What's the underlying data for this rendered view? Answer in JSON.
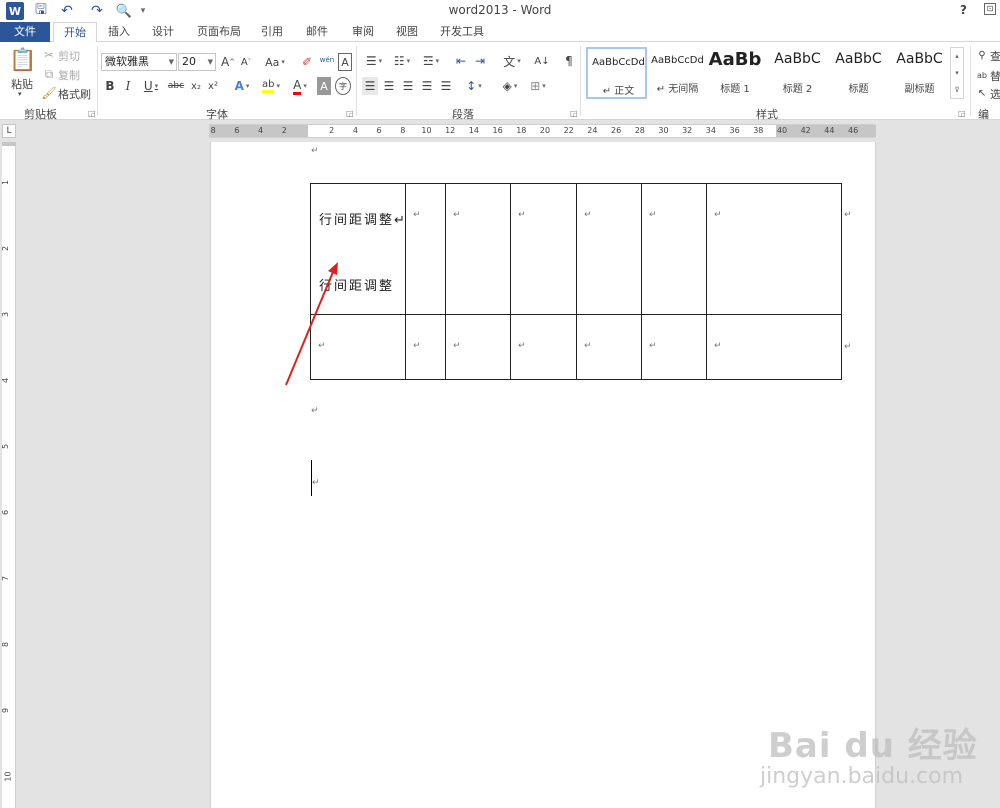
{
  "window": {
    "title": "word2013 - Word",
    "help": "?",
    "ribbon_display": "⊡"
  },
  "quick_access": {
    "app_icon": "W",
    "save": "🖫",
    "undo": "↶",
    "redo": "↷",
    "preview": "🔍",
    "more": "▾"
  },
  "tabs": [
    {
      "label": "文件"
    },
    {
      "label": "开始"
    },
    {
      "label": "插入"
    },
    {
      "label": "设计"
    },
    {
      "label": "页面布局"
    },
    {
      "label": "引用"
    },
    {
      "label": "邮件"
    },
    {
      "label": "审阅"
    },
    {
      "label": "视图"
    },
    {
      "label": "开发工具"
    }
  ],
  "clipboard": {
    "group_label": "剪贴板",
    "paste": "粘贴",
    "cut": "剪切",
    "copy": "复制",
    "format_painter": "格式刷"
  },
  "font": {
    "group_label": "字体",
    "font_name": "微软雅黑",
    "font_size": "20",
    "grow": "A",
    "shrink": "A",
    "change_case": "Aa",
    "clear_format": "✐",
    "phonetic": "wén",
    "char_border": "A",
    "bold": "B",
    "italic": "I",
    "underline": "U",
    "strike": "abc",
    "subscript": "x₂",
    "superscript": "x²",
    "text_effect": "A",
    "highlight": "ab",
    "font_color": "A",
    "char_shading": "A",
    "enclose": "字"
  },
  "paragraph": {
    "group_label": "段落",
    "bullets": "☰",
    "numbering": "☷",
    "multilevel": "☲",
    "decrease_indent": "⇤",
    "increase_indent": "⇥",
    "chinese_layout": "文",
    "sort": "A↓",
    "show_marks": "¶",
    "align_left": "☰",
    "center": "☰",
    "align_right": "☰",
    "justify": "☰",
    "distributed": "☰",
    "line_spacing": "↕",
    "shading": "◈",
    "borders": "⊞"
  },
  "styles": {
    "group_label": "样式",
    "items": [
      {
        "sample": "AaBbCcDd",
        "name": "↵ 正文"
      },
      {
        "sample": "AaBbCcDd",
        "name": "↵ 无间隔"
      },
      {
        "sample": "AaBb",
        "name": "标题 1"
      },
      {
        "sample": "AaBbC",
        "name": "标题 2"
      },
      {
        "sample": "AaBbC",
        "name": "标题"
      },
      {
        "sample": "AaBbC",
        "name": "副标题"
      }
    ],
    "scroll_up": "▴",
    "scroll_down": "▾",
    "more": "⊽"
  },
  "editing": {
    "group_label": "编",
    "find": "查",
    "replace": "替",
    "select": "选"
  },
  "ruler": {
    "corner": "L",
    "ticks": [
      "8",
      "6",
      "4",
      "2",
      "2",
      "4",
      "6",
      "8",
      "10",
      "12",
      "14",
      "16",
      "18",
      "20",
      "22",
      "24",
      "26",
      "28",
      "30",
      "32",
      "34",
      "36",
      "38",
      "40",
      "42",
      "44",
      "46"
    ],
    "vticks": [
      "1",
      "2",
      "3",
      "4",
      "5",
      "6",
      "7",
      "8",
      "9",
      "10"
    ]
  },
  "document": {
    "para_mark": "↵",
    "cell_1_line_1": "行间距调整↵",
    "cell_1_line_2": "行间距调整"
  },
  "watermark": {
    "main": "Bai du 经验",
    "sub": "jingyan.baidu.com"
  },
  "colors": {
    "word_blue": "#2b579a",
    "annotation_arrow": "#e02020",
    "font_color_bar": "#ff0000",
    "highlight_bar": "#ffff00"
  }
}
